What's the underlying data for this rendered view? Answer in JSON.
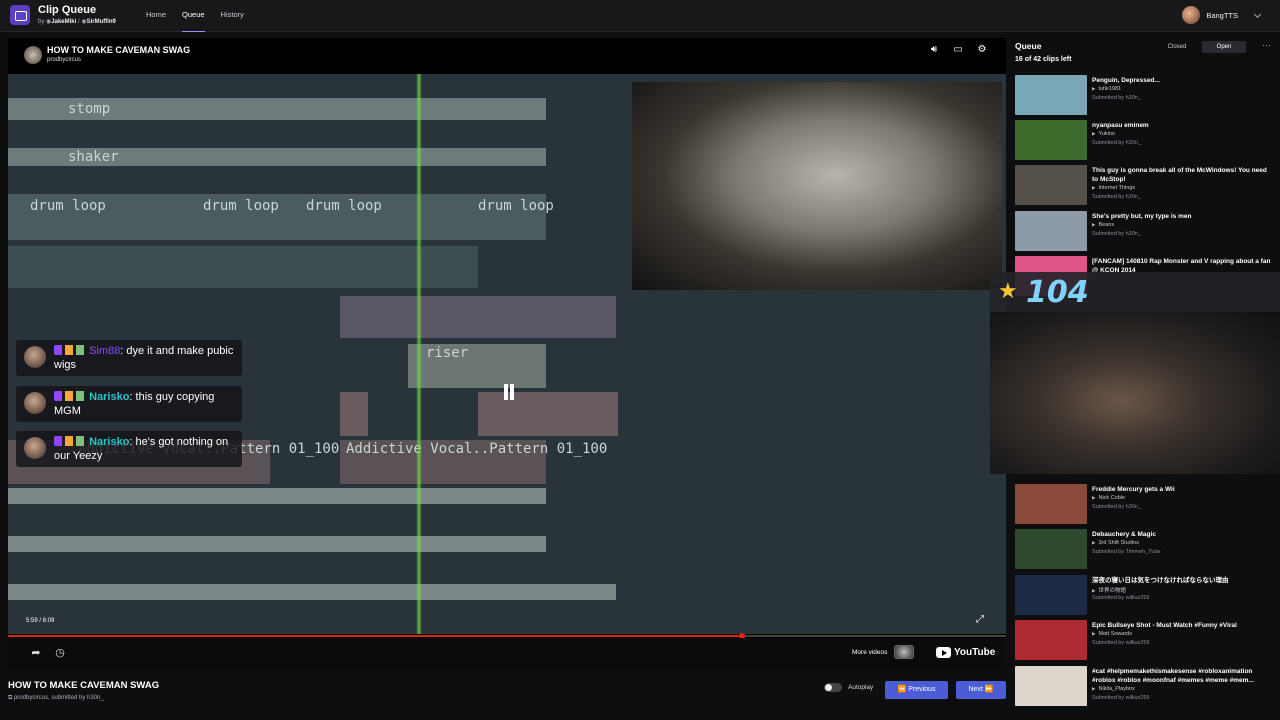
{
  "app": {
    "title": "Clip Queue",
    "by_prefix": "by",
    "author1": "JakeMiki",
    "author2": "SirMuffin9",
    "nav": [
      "Home",
      "Queue",
      "History"
    ],
    "active_nav": "Queue",
    "username": "BangTTS"
  },
  "player": {
    "title": "HOW TO MAKE CAVEMAN SWAG",
    "channel": "prodbycircus",
    "time": "5:59 / 8:09",
    "progress": 0.735,
    "more_videos": "More videos",
    "youtube": "YouTube",
    "daw_clips": [
      "stomp",
      "shaker",
      "drum loop",
      "drum loop",
      "drum loop",
      "drum loop",
      "riser",
      "Addictive Vocal..Pattern 01_100",
      "Addictive Vocal..Pattern 01_100"
    ]
  },
  "chat": [
    {
      "nick": "Sim88",
      "msg": ": dye it and make pubic wigs"
    },
    {
      "nick": "Narisko",
      "msg": ": this guy copying MGM"
    },
    {
      "nick": "Narisko",
      "msg": ": he's got nothing on our  Yeezy"
    }
  ],
  "overlay": {
    "count": "104"
  },
  "below": {
    "title": "HOW TO MAKE CAVEMAN SWAG",
    "channel": "prodbycircus",
    "submitted_text": ", submitted by",
    "submitter": "h30n_",
    "autoplay": "Autoplay",
    "previous": "Previous",
    "next": "Next"
  },
  "queue": {
    "title": "Queue",
    "count_text": "16 of 42 clips left",
    "tab_closed": "Closed",
    "tab_open": "Open",
    "items": [
      {
        "title": "Penguin, Depressed...",
        "channel": "tutle1981",
        "submitter": "Submitted by h30n_",
        "color": "#7aa7b5"
      },
      {
        "title": "nyanpasu eminem",
        "channel": "Yukino",
        "submitter": "Submitted by h30n_",
        "color": "#3b6a2a"
      },
      {
        "title": "This guy is gonna break all of the McWindows! You need to McStop!",
        "channel": "Internet Things",
        "submitter": "Submitted by h30n_",
        "color": "#555048"
      },
      {
        "title": "She's pretty but, my type is men",
        "channel": "Beans",
        "submitter": "Submitted by h30n_",
        "color": "#8d9aa8"
      },
      {
        "title": "[FANCAM] 140810 Rap Monster and V rapping about a fan @ KCON 2014",
        "channel": "",
        "submitter": "",
        "color": "#e0558a"
      },
      {
        "title": "Freddie Mercury gets a Wii",
        "channel": "Nick Coble",
        "submitter": "Submitted by h30n_",
        "color": "#8a4a3a"
      },
      {
        "title": "Debauchery & Magic",
        "channel": "3rd Shift Studios",
        "submitter": "Submitted by Timmeh_Tube",
        "color": "#2e4a2e"
      },
      {
        "title": "深夜の寝い日は気をつけなければならない理由",
        "channel": "世界の物語",
        "submitter": "Submitted by willius259",
        "color": "#1c2a44"
      },
      {
        "title": "Epic Bullseye Shot - Must Watch #Funny #Viral",
        "channel": "Matt Sowards",
        "submitter": "Submitted by willius259",
        "color": "#b02a34"
      },
      {
        "title": "#cat #helpmemakethismakesense #robloxanimation #roblox #roblox #moonfnaf #memes #meme #mem...",
        "channel": "Nikita_Playbox",
        "submitter": "Submitted by willius259",
        "color": "#ddd6cc"
      }
    ]
  }
}
